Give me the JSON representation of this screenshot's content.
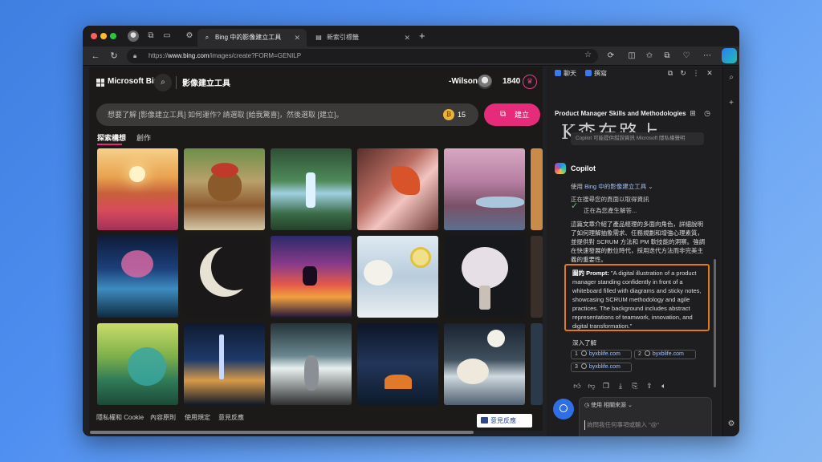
{
  "browser": {
    "tabs": [
      {
        "label": "Bing 中的影像建立工具",
        "active": true
      },
      {
        "label": "新索引標籤",
        "active": false
      }
    ],
    "url_prefix": "https://",
    "url_host": "www.bing.com",
    "url_path": "/images/create?FORM=GENILP"
  },
  "bing": {
    "brand": "Microsoft Bing",
    "tool_title": "影像建立工具",
    "username": "-Wilson-",
    "points": "1840",
    "prompt_placeholder": "想要了解 [影像建立工具] 如何運作? 請選取 [給我驚喜]，然後選取 [建立]。",
    "boosts": "15",
    "create_label": "建立",
    "subtabs": [
      "探索構想",
      "創作"
    ],
    "footer_links": [
      "隱私權和 Cookie",
      "內容原則",
      "使用規定",
      "意見反應"
    ],
    "feedback_button": "意見反應"
  },
  "sidepane": {
    "tabs": [
      "聊天",
      "撰寫"
    ],
    "topic": "Product Manager Skills and Methodologies",
    "watermark": "K森在路上",
    "notice": "Copilot 可能提供錯誤資訊 Microsoft 隱私權聲明",
    "copilot_name": "Copilot",
    "using_prefix": "使用 ",
    "using_tool": "Bing 中的影像建立工具",
    "searching": "正在搜尋您的頁面以取得資訊",
    "generating": "正在為您產生解答...",
    "summary": "這篇文章介紹了產品經理的多面向角色，詳細說明了如何理解抽象需求、任務規劃和增強心理素質，並提供對 SCRUM 方法和 PM 軟技能的洞察。強調在快速發展的數位時代，採用迭代方法而非完美主義的重要性。",
    "prompt_label": "圖的 Prompt:",
    "prompt_text": "\"A digital illustration of a product manager standing confidently in front of a whiteboard filled with diagrams and sticky notes, showcasing SCRUM methodology and agile practices. The background includes abstract representations of teamwork, innovation, and digital transformation.\"",
    "learn_more": "深入了解",
    "references": [
      {
        "num": "1",
        "label": "byxblife.com"
      },
      {
        "num": "2",
        "label": "byxblife.com"
      },
      {
        "num": "3",
        "label": "byxblife.com"
      }
    ],
    "compose_source": "使用 相關來源",
    "compose_placeholder": "詢問我任何事項或輸入 \"@\""
  },
  "icons": {
    "tab_close": "✕",
    "new_tab": "+",
    "back": "←",
    "refresh": "↻",
    "star": "☆",
    "search": "⌕",
    "check": "✓",
    "chevron": "⌄"
  },
  "colors": {
    "accent_pink": "#e62b7a",
    "prompt_border": "#e07b1c",
    "link_blue": "#9fc2ff"
  }
}
